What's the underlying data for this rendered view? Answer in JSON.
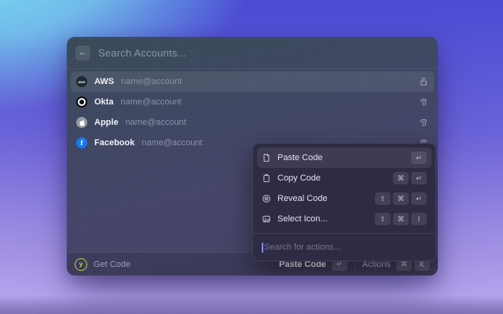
{
  "window_title": "account-switcher",
  "colors": {
    "bg_cyan": "#7ee3f2",
    "bg_blue": "#4a4cd4",
    "bg_purple": "#b3a2ec",
    "facebook_blue": "#1877f2",
    "okta_black": "#0a0a0f",
    "apple_gray": "#969aa1",
    "aws_navy": "#1f2a37",
    "yubico_green": "#b9d43a",
    "caret": "#8b8af0"
  },
  "header": {
    "back_icon": "←",
    "search_placeholder": "Search Accounts..."
  },
  "accounts": [
    {
      "name": "AWS",
      "detail": "name@account",
      "brand_glyph": "aws",
      "right_icon": "unlock-icon",
      "selected": true
    },
    {
      "name": "Okta",
      "detail": "name@account",
      "brand_glyph": "",
      "right_icon": "fingerprint-icon",
      "selected": false
    },
    {
      "name": "Apple",
      "detail": "name@account",
      "brand_glyph": "",
      "right_icon": "fingerprint-icon",
      "selected": false
    },
    {
      "name": "Facebook",
      "detail": "name@account",
      "brand_glyph": "f",
      "right_icon": "fingerprint-icon",
      "selected": false
    }
  ],
  "actions_menu": {
    "items": [
      {
        "label": "Paste Code",
        "icon": "document-icon",
        "keys": [
          "↵"
        ],
        "selected": true
      },
      {
        "label": "Copy Code",
        "icon": "clipboard-icon",
        "keys": [
          "⌘",
          "↵"
        ],
        "selected": false
      },
      {
        "label": "Reveal Code",
        "icon": "reveal-icon",
        "keys": [
          "⇧",
          "⌘",
          "↵"
        ],
        "selected": false
      },
      {
        "label": "Select Icon...",
        "icon": "image-icon",
        "keys": [
          "⇧",
          "⌘",
          "I"
        ],
        "selected": false
      }
    ],
    "search_placeholder": "Search for actions..."
  },
  "footer": {
    "app_icon_glyph": "y",
    "app_label": "Get Code",
    "primary_action": "Paste Code",
    "primary_key": "↵",
    "secondary_action": "Actions",
    "secondary_keys": [
      "⌘",
      "K"
    ]
  }
}
